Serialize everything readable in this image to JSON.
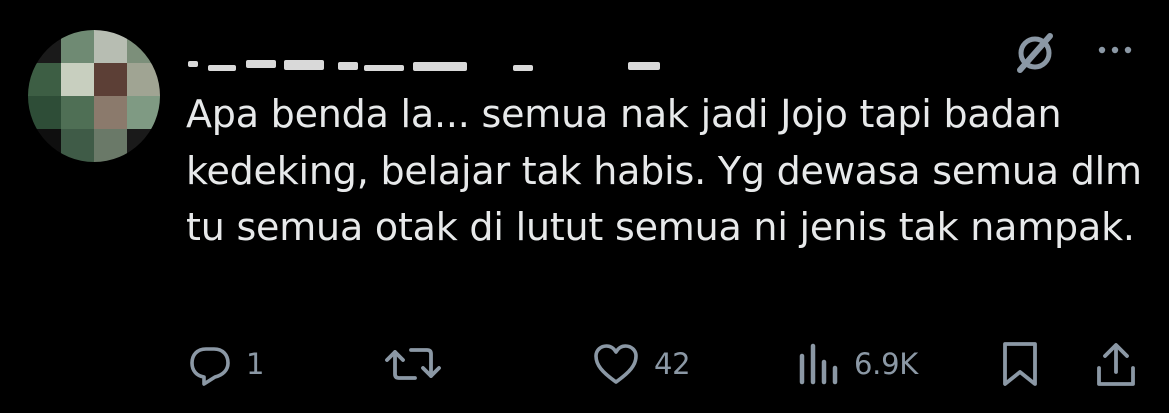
{
  "post": {
    "author_name_redacted": true,
    "text": "Apa benda la... semua nak jadi Jojo tapi badan kedeking, belajar tak habis. Yg dewasa semua dlm tu semua otak di lutut semua ni jenis tak nampak."
  },
  "top_actions": {
    "grok_icon": "grok-icon",
    "more_icon": "more-icon"
  },
  "actions": {
    "reply": {
      "icon": "reply-icon",
      "count": "1"
    },
    "repost": {
      "icon": "repost-icon",
      "count": ""
    },
    "like": {
      "icon": "like-icon",
      "count": "42"
    },
    "views": {
      "icon": "views-icon",
      "count": "6.9K"
    },
    "bookmark": {
      "icon": "bookmark-icon"
    },
    "share": {
      "icon": "share-icon"
    }
  },
  "colors": {
    "background": "#000000",
    "text": "#e7e9ea",
    "secondary": "#8b98a5"
  }
}
